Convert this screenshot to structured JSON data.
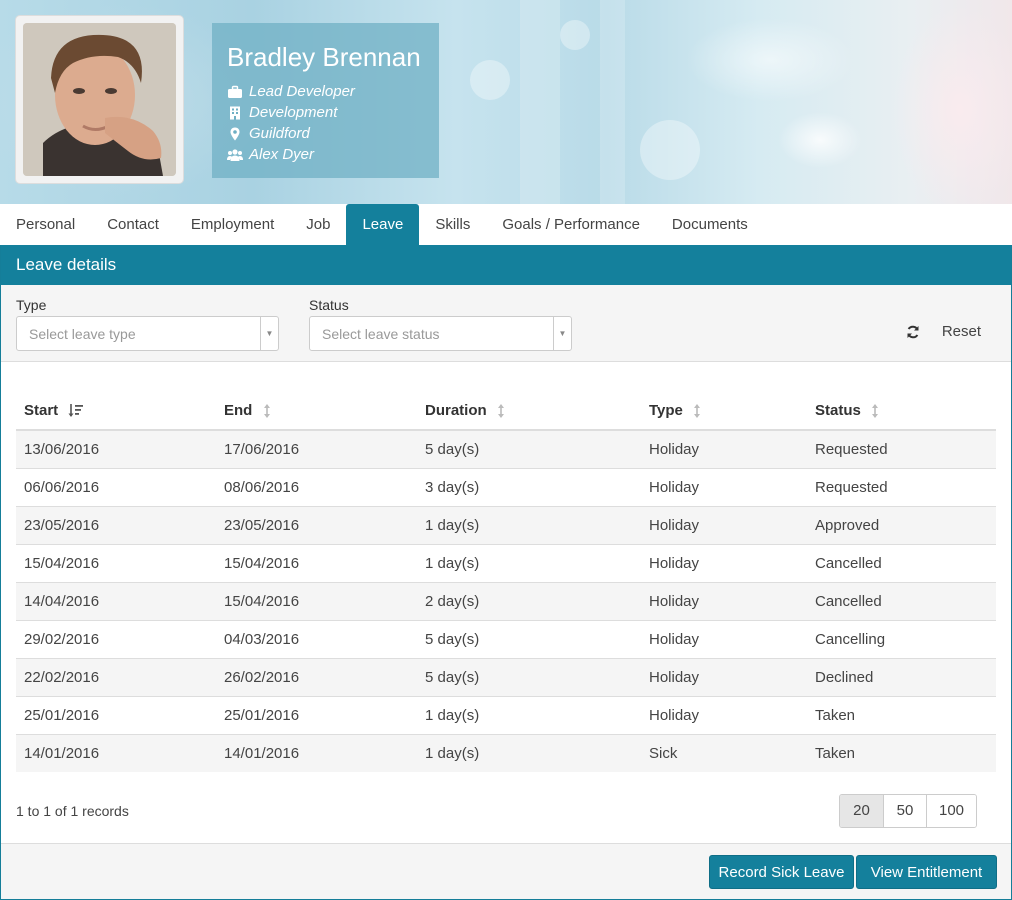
{
  "profile": {
    "name": "Bradley Brennan",
    "job_title": "Lead Developer",
    "department": "Development",
    "location": "Guildford",
    "manager": "Alex Dyer"
  },
  "tabs": [
    {
      "label": "Personal"
    },
    {
      "label": "Contact"
    },
    {
      "label": "Employment"
    },
    {
      "label": "Job"
    },
    {
      "label": "Leave",
      "active": true
    },
    {
      "label": "Skills"
    },
    {
      "label": "Goals / Performance"
    },
    {
      "label": "Documents"
    }
  ],
  "panel": {
    "title": "Leave details"
  },
  "filters": {
    "type_label": "Type",
    "type_placeholder": "Select leave type",
    "status_label": "Status",
    "status_placeholder": "Select leave status",
    "reset_label": "Reset"
  },
  "table": {
    "columns": [
      "Start",
      "End",
      "Duration",
      "Type",
      "Status"
    ],
    "rows": [
      [
        "13/06/2016",
        "17/06/2016",
        "5 day(s)",
        "Holiday",
        "Requested"
      ],
      [
        "06/06/2016",
        "08/06/2016",
        "3 day(s)",
        "Holiday",
        "Requested"
      ],
      [
        "23/05/2016",
        "23/05/2016",
        "1 day(s)",
        "Holiday",
        "Approved"
      ],
      [
        "15/04/2016",
        "15/04/2016",
        "1 day(s)",
        "Holiday",
        "Cancelled"
      ],
      [
        "14/04/2016",
        "15/04/2016",
        "2 day(s)",
        "Holiday",
        "Cancelled"
      ],
      [
        "29/02/2016",
        "04/03/2016",
        "5 day(s)",
        "Holiday",
        "Cancelling"
      ],
      [
        "22/02/2016",
        "26/02/2016",
        "5 day(s)",
        "Holiday",
        "Declined"
      ],
      [
        "25/01/2016",
        "25/01/2016",
        "1 day(s)",
        "Holiday",
        "Taken"
      ],
      [
        "14/01/2016",
        "14/01/2016",
        "1 day(s)",
        "Sick",
        "Taken"
      ]
    ]
  },
  "pagination": {
    "records_text": "1 to 1 of 1 records",
    "page_sizes": [
      "20",
      "50",
      "100"
    ],
    "selected": "20"
  },
  "footer": {
    "record_sick_leave": "Record Sick Leave",
    "view_entitlement": "View Entitlement"
  },
  "colors": {
    "accent": "#14809c"
  }
}
